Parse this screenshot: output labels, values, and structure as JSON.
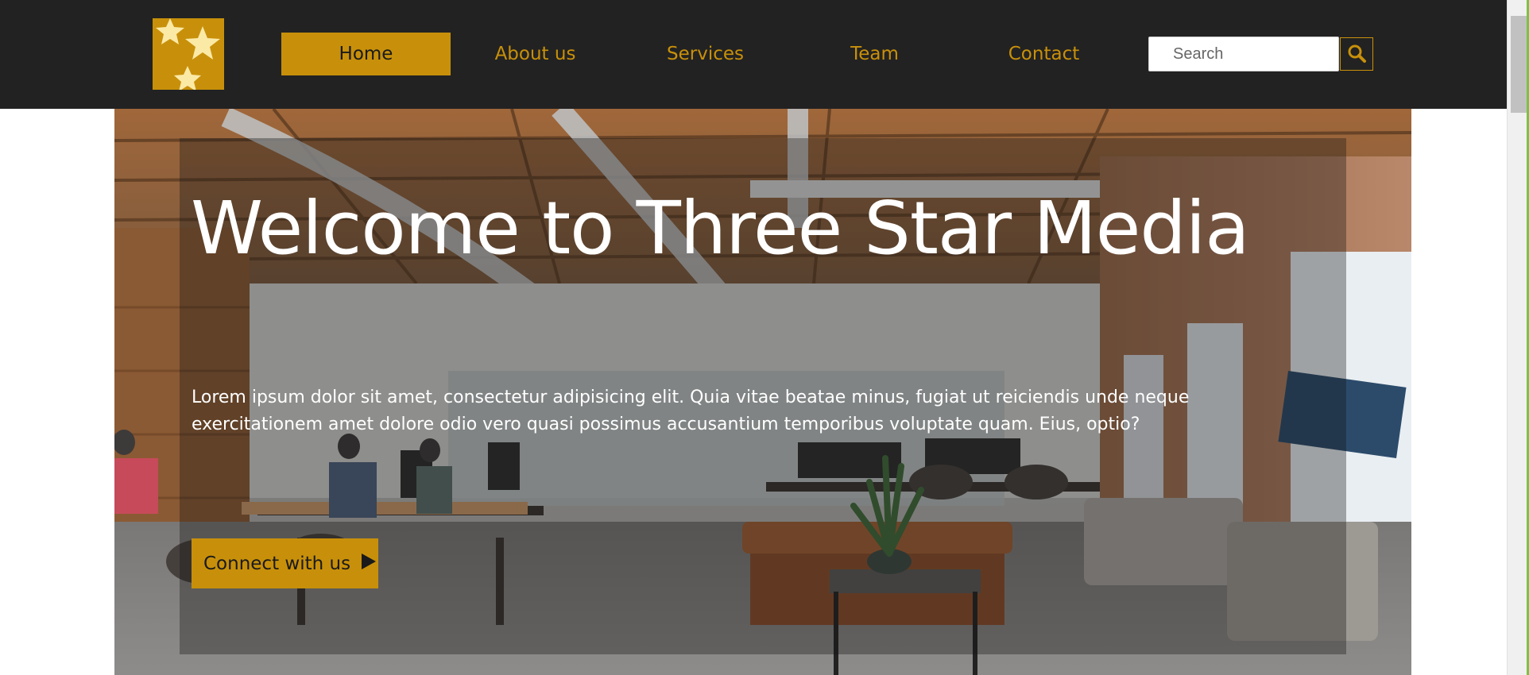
{
  "brand": {
    "logo_icon": "three-stars-logo-icon",
    "accent_color": "#c8900a",
    "bar_color": "#222222"
  },
  "nav": {
    "items": [
      {
        "label": "Home",
        "active": true
      },
      {
        "label": "About us",
        "active": false
      },
      {
        "label": "Services",
        "active": false
      },
      {
        "label": "Team",
        "active": false
      },
      {
        "label": "Contact",
        "active": false
      }
    ]
  },
  "search": {
    "placeholder": "Search",
    "button_icon": "search-icon"
  },
  "hero": {
    "title": "Welcome to Three Star Media",
    "text": "Lorem ipsum dolor sit amet, consectetur adipisicing elit. Quia vitae beatae minus, fugiat ut reiciendis unde neque exercitationem amet dolore odio vero quasi possimus accusantium temporibus voluptate quam. Eius, optio?",
    "cta_label": "Connect with us",
    "cta_icon": "play-icon"
  }
}
